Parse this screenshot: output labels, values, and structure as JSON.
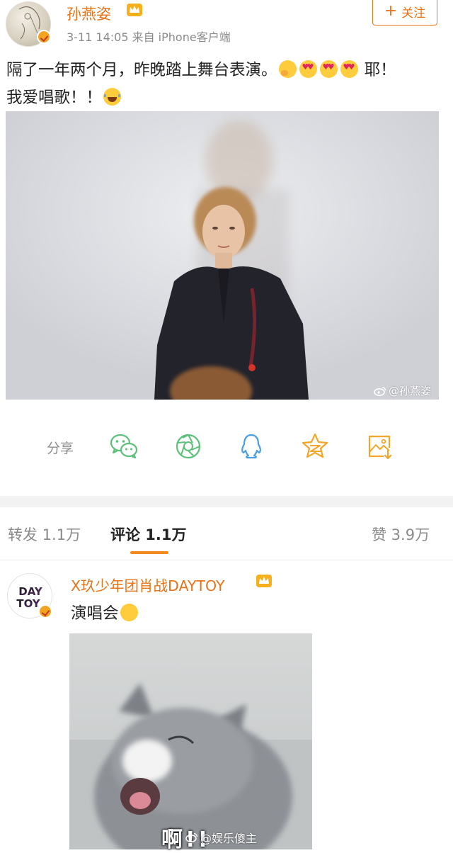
{
  "post": {
    "author": "孙燕姿",
    "meta": "3-11 14:05  来自 iPhone客户端",
    "follow_label": "关注",
    "text_line1": "隔了一年两个月，昨晚踏上舞台表演。",
    "text_line1_tail": "耶！",
    "text_line2": "我爱唱歌！！",
    "photo_watermark": "@孙燕姿"
  },
  "share": {
    "label": "分享",
    "icons": [
      "wechat-icon",
      "moments-icon",
      "qq-icon",
      "qzone-icon",
      "save-image-icon"
    ]
  },
  "tabs": {
    "repost": "转发 1.1万",
    "comment": "评论 1.1万",
    "like": "赞 3.9万"
  },
  "comment": {
    "author": "X玖少年团肖战DAYTOY",
    "avatar_text_top": "DAY",
    "avatar_text_bottom": "TOY",
    "text": "演唱会",
    "image_caption": "啊!!",
    "page_watermark": "@娱乐傻主"
  },
  "colors": {
    "accent": "#e8741a",
    "tab_underline": "#f08c1f",
    "icon_green": "#5cbf7a",
    "icon_blue": "#4a9fe0",
    "icon_orange": "#f2a62b"
  }
}
